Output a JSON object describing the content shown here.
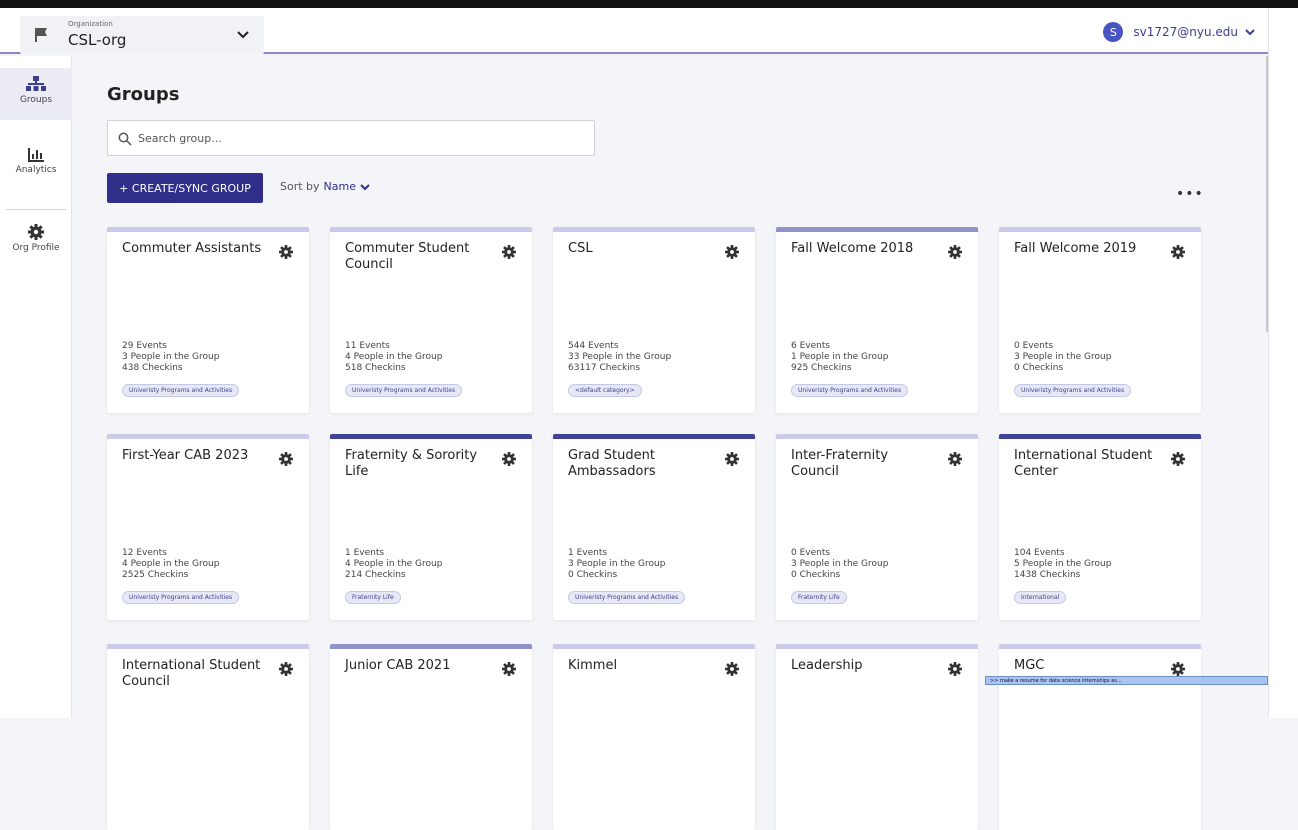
{
  "org": {
    "label": "Organization",
    "name": "CSL-org"
  },
  "user": {
    "initial": "S",
    "email": "sv1727@nyu.edu"
  },
  "sidebar": {
    "items": [
      {
        "label": "Groups",
        "icon": "groups-icon"
      },
      {
        "label": "Analytics",
        "icon": "analytics-icon"
      },
      {
        "label": "Org Profile",
        "icon": "gear-icon"
      }
    ]
  },
  "page": {
    "title": "Groups",
    "search_placeholder": "Search group...",
    "create_label": "+ CREATE/SYNC GROUP",
    "sort_label": "Sort by",
    "sort_value": "Name",
    "more_label": "•••"
  },
  "groups": [
    {
      "name": "Commuter Assistants",
      "events": "29 Events",
      "people": "3 People in the Group",
      "checkins": "438 Checkins",
      "tag": "Univeristy Programs and Activities"
    },
    {
      "name": "Commuter Student Council",
      "events": "11 Events",
      "people": "4 People in the Group",
      "checkins": "518 Checkins",
      "tag": "Univeristy Programs and Activities"
    },
    {
      "name": "CSL",
      "events": "544 Events",
      "people": "33 People in the Group",
      "checkins": "63117 Checkins",
      "tag": "<default category>"
    },
    {
      "name": "Fall Welcome 2018",
      "events": "6 Events",
      "people": "1 People in the Group",
      "checkins": "925 Checkins",
      "tag": "Univeristy Programs and Activities"
    },
    {
      "name": "Fall Welcome 2019",
      "events": "0 Events",
      "people": "3 People in the Group",
      "checkins": "0 Checkins",
      "tag": "Univeristy Programs and Activities"
    },
    {
      "name": "First-Year CAB 2023",
      "events": "12 Events",
      "people": "4 People in the Group",
      "checkins": "2525 Checkins",
      "tag": "Univeristy Programs and Activities"
    },
    {
      "name": "Fraternity & Sorority Life",
      "events": "1 Events",
      "people": "4 People in the Group",
      "checkins": "214 Checkins",
      "tag": "Fraternity Life"
    },
    {
      "name": "Grad Student Ambassadors",
      "events": "1 Events",
      "people": "3 People in the Group",
      "checkins": "0 Checkins",
      "tag": "Univeristy Programs and Activities"
    },
    {
      "name": "Inter-Fraternity Council",
      "events": "0 Events",
      "people": "3 People in the Group",
      "checkins": "0 Checkins",
      "tag": "Fraternity Life"
    },
    {
      "name": "International Student Center",
      "events": "104 Events",
      "people": "5 People in the Group",
      "checkins": "1438 Checkins",
      "tag": "International"
    },
    {
      "name": "International Student Council"
    },
    {
      "name": "Junior CAB 2021"
    },
    {
      "name": "Kimmel"
    },
    {
      "name": "Leadership"
    },
    {
      "name": "MGC"
    }
  ],
  "tooltip": {
    "text": ">> make a resume for data science internships as..."
  }
}
